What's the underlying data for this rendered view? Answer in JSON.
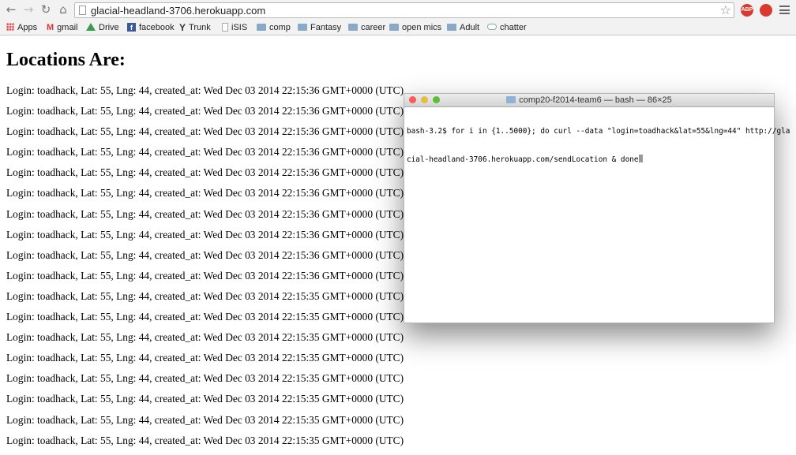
{
  "browser": {
    "url": "glacial-headland-3706.herokuapp.com",
    "bookmarks": [
      {
        "label": "Apps",
        "icon": "apps-grid-icon"
      },
      {
        "label": "gmail",
        "icon": "gmail-icon"
      },
      {
        "label": "Drive",
        "icon": "drive-icon"
      },
      {
        "label": "facebook",
        "icon": "facebook-icon"
      },
      {
        "label": "Trunk",
        "icon": "trunk-icon"
      },
      {
        "label": "iSIS",
        "icon": "page-icon"
      },
      {
        "label": "comp",
        "icon": "folder-icon"
      },
      {
        "label": "Fantasy",
        "icon": "folder-icon"
      },
      {
        "label": "career",
        "icon": "folder-icon"
      },
      {
        "label": "open mics",
        "icon": "folder-icon"
      },
      {
        "label": "Adult",
        "icon": "folder-icon"
      },
      {
        "label": "chatter",
        "icon": "cloud-icon"
      }
    ],
    "extensions": {
      "abp_label": "ABP",
      "abp_color": "#d9392e",
      "second_color": "#d9392e"
    }
  },
  "page": {
    "title": "Locations Are:",
    "locations": [
      "Login: toadhack, Lat: 55, Lng: 44, created_at: Wed Dec 03 2014 22:15:36 GMT+0000 (UTC)",
      "Login: toadhack, Lat: 55, Lng: 44, created_at: Wed Dec 03 2014 22:15:36 GMT+0000 (UTC)",
      "Login: toadhack, Lat: 55, Lng: 44, created_at: Wed Dec 03 2014 22:15:36 GMT+0000 (UTC)",
      "Login: toadhack, Lat: 55, Lng: 44, created_at: Wed Dec 03 2014 22:15:36 GMT+0000 (UTC)",
      "Login: toadhack, Lat: 55, Lng: 44, created_at: Wed Dec 03 2014 22:15:36 GMT+0000 (UTC)",
      "Login: toadhack, Lat: 55, Lng: 44, created_at: Wed Dec 03 2014 22:15:36 GMT+0000 (UTC)",
      "Login: toadhack, Lat: 55, Lng: 44, created_at: Wed Dec 03 2014 22:15:36 GMT+0000 (UTC)",
      "Login: toadhack, Lat: 55, Lng: 44, created_at: Wed Dec 03 2014 22:15:36 GMT+0000 (UTC)",
      "Login: toadhack, Lat: 55, Lng: 44, created_at: Wed Dec 03 2014 22:15:36 GMT+0000 (UTC)",
      "Login: toadhack, Lat: 55, Lng: 44, created_at: Wed Dec 03 2014 22:15:36 GMT+0000 (UTC)",
      "Login: toadhack, Lat: 55, Lng: 44, created_at: Wed Dec 03 2014 22:15:35 GMT+0000 (UTC)",
      "Login: toadhack, Lat: 55, Lng: 44, created_at: Wed Dec 03 2014 22:15:35 GMT+0000 (UTC)",
      "Login: toadhack, Lat: 55, Lng: 44, created_at: Wed Dec 03 2014 22:15:35 GMT+0000 (UTC)",
      "Login: toadhack, Lat: 55, Lng: 44, created_at: Wed Dec 03 2014 22:15:35 GMT+0000 (UTC)",
      "Login: toadhack, Lat: 55, Lng: 44, created_at: Wed Dec 03 2014 22:15:35 GMT+0000 (UTC)",
      "Login: toadhack, Lat: 55, Lng: 44, created_at: Wed Dec 03 2014 22:15:35 GMT+0000 (UTC)",
      "Login: toadhack, Lat: 55, Lng: 44, created_at: Wed Dec 03 2014 22:15:35 GMT+0000 (UTC)",
      "Login: toadhack, Lat: 55, Lng: 44, created_at: Wed Dec 03 2014 22:15:35 GMT+0000 (UTC)"
    ]
  },
  "terminal": {
    "title": "comp20-f2014-team6 — bash — 86×25",
    "lines": [
      "bash-3.2$ for i in {1..5000}; do curl --data \"login=toadhack&lat=55&lng=44\" http://gla",
      "cial-headland-3706.herokuapp.com/sendLocation & done"
    ],
    "colors": {
      "close": "#fc5b57",
      "minimize": "#e5bf3c",
      "zoom": "#57c038"
    }
  }
}
